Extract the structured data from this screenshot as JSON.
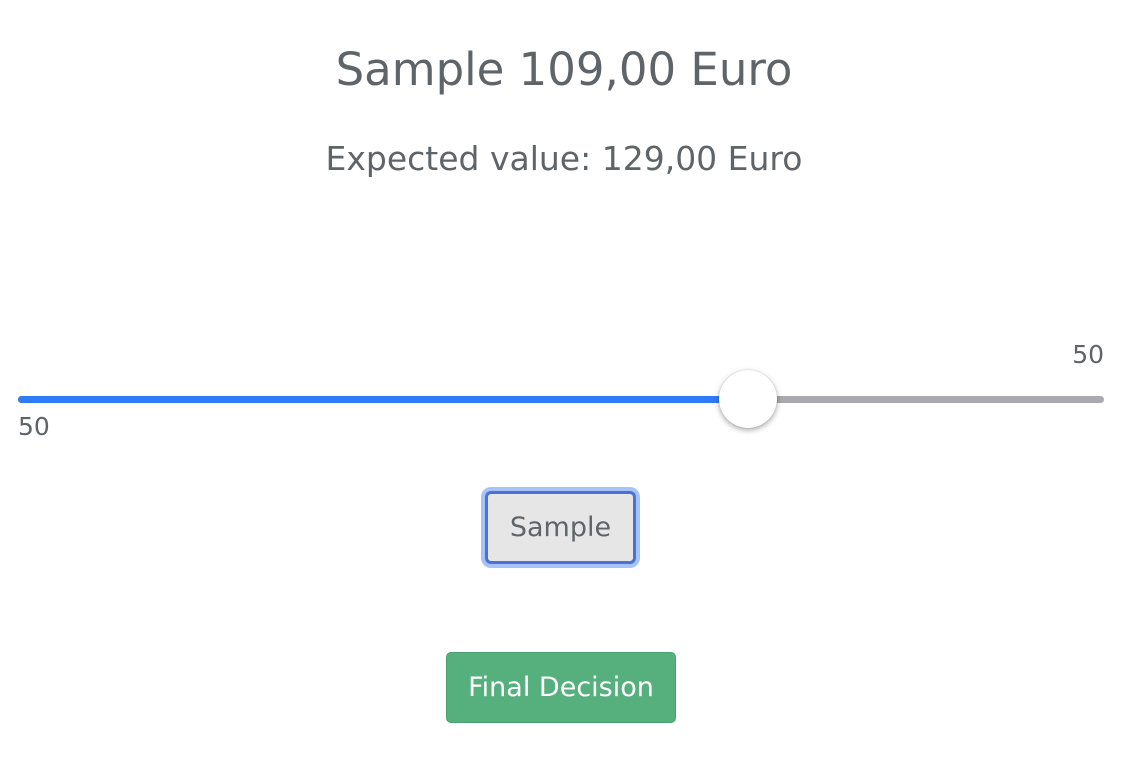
{
  "header": {
    "title": "Sample 109,00 Euro",
    "expected_value": "Expected value: 129,00 Euro"
  },
  "slider": {
    "min_label": "50",
    "max_label": "50",
    "fill_fraction": 0.672,
    "fill_color": "#2f7cf6",
    "track_color": "#a9a9ae"
  },
  "buttons": {
    "sample_label": "Sample",
    "final_decision_label": "Final Decision",
    "final_color": "#56b07e"
  }
}
